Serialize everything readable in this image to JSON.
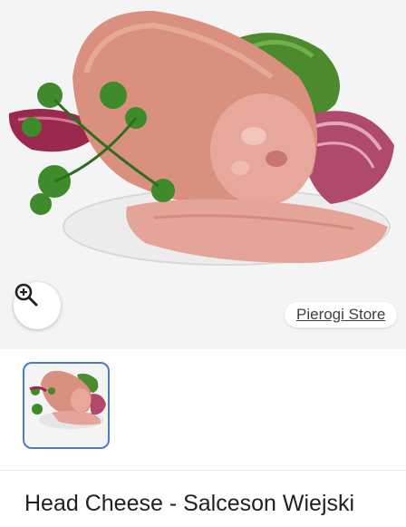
{
  "source": {
    "label": "Pierogi Store"
  },
  "product": {
    "title": "Head Cheese - Salceson Wiejski"
  },
  "icons": {
    "zoom": "zoom-in-icon"
  },
  "colors": {
    "thumb_border": "#4a7bd4",
    "hero_bg": "#f4f4f4"
  }
}
